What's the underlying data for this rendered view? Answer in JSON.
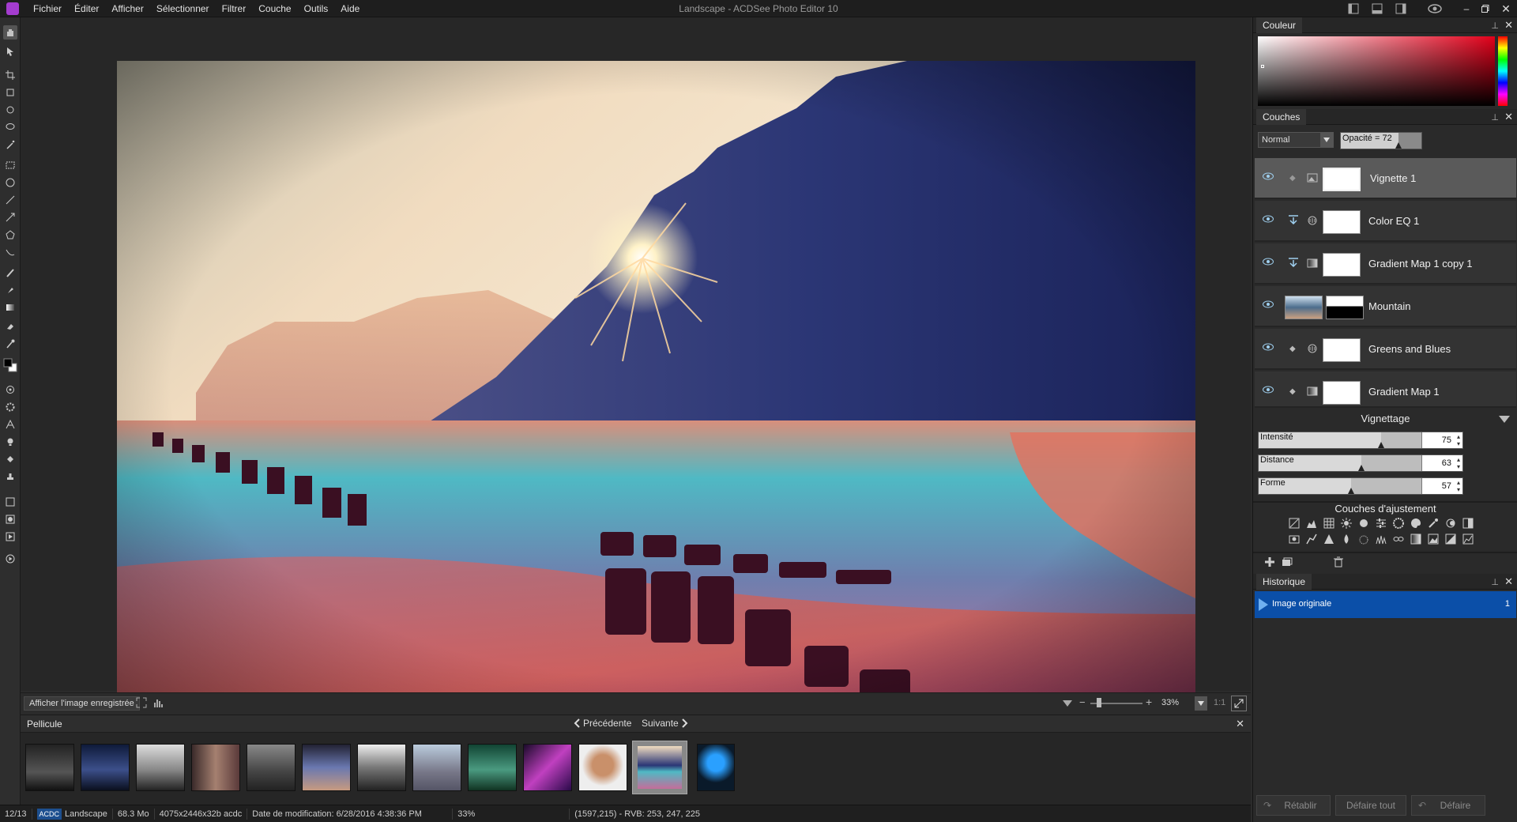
{
  "menubar": {
    "items": [
      "Fichier",
      "Éditer",
      "Afficher",
      "Sélectionner",
      "Filtrer",
      "Couche",
      "Outils",
      "Aide"
    ],
    "window_title": "Landscape - ACDSee Photo Editor 10"
  },
  "canvas_footer": {
    "show_saved_label": "Afficher l'image enregistrée",
    "zoom_value": "33%",
    "ratio_label": "1:1"
  },
  "filmstrip": {
    "tab_label": "Pellicule",
    "prev_label": "Précédente",
    "next_label": "Suivante"
  },
  "status": {
    "index": "12/13",
    "format_badge": "ACDC",
    "filename": "Landscape",
    "filesize": "68.3 Mo",
    "dimensions": "4075x2446x32b acdc",
    "modified": "Date de modification: 6/28/2016 4:38:36 PM",
    "zoom": "33%",
    "pixel_info": "(1597,215) - RVB: 253, 247, 225"
  },
  "color_panel": {
    "tab_label": "Couleur"
  },
  "layers_panel": {
    "tab_label": "Couches",
    "blend_mode": "Normal",
    "opacity_label": "Opacité = 72",
    "opacity_value": 72,
    "layers": [
      {
        "name": "Vignette  1",
        "selected": true
      },
      {
        "name": "Color EQ  1",
        "selected": false
      },
      {
        "name": "Gradient Map  1 copy 1",
        "selected": false
      },
      {
        "name": "Mountain",
        "selected": false
      },
      {
        "name": "Greens and Blues",
        "selected": false
      },
      {
        "name": "Gradient Map  1",
        "selected": false
      }
    ]
  },
  "vignette": {
    "title": "Vignettage",
    "sliders": [
      {
        "label": "Intensité",
        "value": "75",
        "fraction": 0.75
      },
      {
        "label": "Distance",
        "value": "63",
        "fraction": 0.63
      },
      {
        "label": "Forme",
        "value": "57",
        "fraction": 0.57
      }
    ]
  },
  "adjust_layers": {
    "title": "Couches d'ajustement"
  },
  "history_panel": {
    "tab_label": "Historique",
    "entry_label": "Image originale",
    "entry_count": "1"
  },
  "history_buttons": {
    "redo": "Rétablir",
    "undo_all": "Défaire tout",
    "undo": "Défaire"
  },
  "colors": {
    "accent_selected": "#0b4fa8",
    "panel_bg": "#2a2a2a",
    "app_logo": "#a43ccf"
  }
}
